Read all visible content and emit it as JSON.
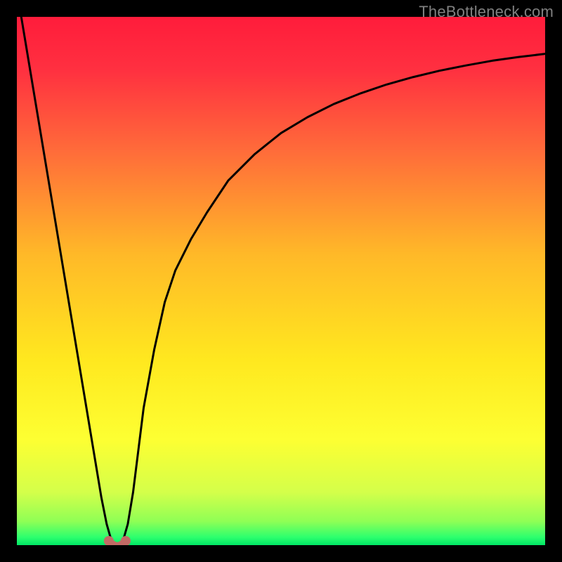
{
  "watermark": "TheBottleneck.com",
  "chart_data": {
    "type": "line",
    "title": "",
    "xlabel": "",
    "ylabel": "",
    "xlim": [
      0,
      100
    ],
    "ylim": [
      0,
      100
    ],
    "series": [
      {
        "name": "curve",
        "x": [
          0,
          2,
          4,
          6,
          8,
          10,
          12,
          14,
          15,
          16,
          17,
          18,
          19,
          20,
          21,
          22,
          23,
          24,
          26,
          28,
          30,
          33,
          36,
          40,
          45,
          50,
          55,
          60,
          65,
          70,
          75,
          80,
          85,
          90,
          95,
          100
        ],
        "y": [
          105,
          93,
          81,
          69,
          57,
          45,
          33,
          21,
          15,
          9,
          4,
          0.5,
          0,
          0.5,
          4,
          10,
          18,
          26,
          37,
          46,
          52,
          58,
          63,
          69,
          74,
          78,
          81,
          83.5,
          85.5,
          87.2,
          88.6,
          89.8,
          90.8,
          91.7,
          92.4,
          93
        ]
      }
    ],
    "markers": [
      {
        "x": 17.4,
        "y": 0.8
      },
      {
        "x": 18.0,
        "y": 0.0
      },
      {
        "x": 18.6,
        "y": -0.3
      },
      {
        "x": 19.4,
        "y": -0.3
      },
      {
        "x": 20.0,
        "y": 0.0
      },
      {
        "x": 20.6,
        "y": 0.8
      }
    ],
    "gradient_stops": [
      {
        "offset": 0.0,
        "color": "#ff1c3b"
      },
      {
        "offset": 0.1,
        "color": "#ff3040"
      },
      {
        "offset": 0.25,
        "color": "#ff6a3a"
      },
      {
        "offset": 0.45,
        "color": "#ffb928"
      },
      {
        "offset": 0.65,
        "color": "#ffe81f"
      },
      {
        "offset": 0.8,
        "color": "#fdff32"
      },
      {
        "offset": 0.9,
        "color": "#d4ff4a"
      },
      {
        "offset": 0.955,
        "color": "#8fff55"
      },
      {
        "offset": 0.985,
        "color": "#2dff6e"
      },
      {
        "offset": 1.0,
        "color": "#00e765"
      }
    ],
    "marker_color": "#c26a65",
    "line_color": "#000000"
  }
}
